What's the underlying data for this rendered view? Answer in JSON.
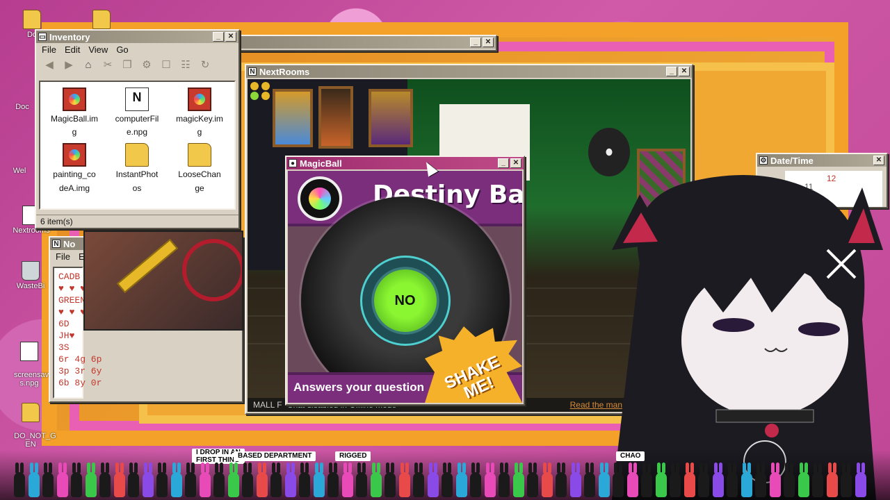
{
  "desktop": {
    "icons": [
      {
        "label": "Do",
        "kind": "folder"
      },
      {
        "label": "Doc",
        "kind": "folder"
      },
      {
        "label": "Wel",
        "kind": "doc"
      },
      {
        "label": "Nextrooms",
        "kind": "doc"
      },
      {
        "label": "WasteBi",
        "kind": "trash"
      },
      {
        "label": "screensav\ns.npg",
        "kind": "doc"
      },
      {
        "label": "DO_NOT_G\nEN",
        "kind": "folder"
      }
    ]
  },
  "inventory": {
    "title": "Inventory",
    "menu": [
      "File",
      "Edit",
      "View",
      "Go"
    ],
    "toolbar_icons": [
      "back-icon",
      "forward-icon",
      "home-icon",
      "cut-icon",
      "copy-icon",
      "settings-icon",
      "gamepad-icon",
      "tree-icon",
      "refresh-icon"
    ],
    "files": [
      {
        "name": "MagicBall.im\ng",
        "kind": "img"
      },
      {
        "name": "computerFil\ne.npg",
        "kind": "npg"
      },
      {
        "name": "magicKey.im\ng",
        "kind": "img"
      },
      {
        "name": "painting_co\ndeA.img",
        "kind": "img"
      },
      {
        "name": "InstantPhot\nos",
        "kind": "fold"
      },
      {
        "name": "LooseChan\nge",
        "kind": "fold"
      }
    ],
    "status": "6 item(s)"
  },
  "nextrooms": {
    "title": "NextRooms",
    "footer_left_prefix": "MALL F",
    "footer_chat": "Chat disabled in Offline mode",
    "footer_right": "Read the man"
  },
  "magicball": {
    "title": "MagicBall",
    "heading": "Destiny Ball",
    "answer": "NO",
    "subtitle": "Answers your question",
    "shake": "SHAKE\nME!"
  },
  "notepad": {
    "title": "No",
    "menu": [
      "File",
      "Ed"
    ],
    "lines": [
      "CADB",
      "♥ ♥ ♥",
      "GREEN",
      "♥ ♥ ♥",
      "6D",
      "JH♥",
      "3S",
      "6r 4g 6p",
      "3p 3r 6y",
      "6b 8y 0r"
    ]
  },
  "datetime": {
    "title": "Date/Time",
    "clock": [
      "11",
      "12"
    ]
  },
  "ticker": {
    "labels": [
      "I DROP IN AN\nFIRST THING",
      "BASED DEPARTMENT",
      "RIGGED",
      "CHAO"
    ]
  },
  "colors": {
    "desktop_bg": "#c4489a",
    "frame_orange": "#f4a12a",
    "magic_purple": "#7a2e7c",
    "answer_green": "#8af531"
  }
}
